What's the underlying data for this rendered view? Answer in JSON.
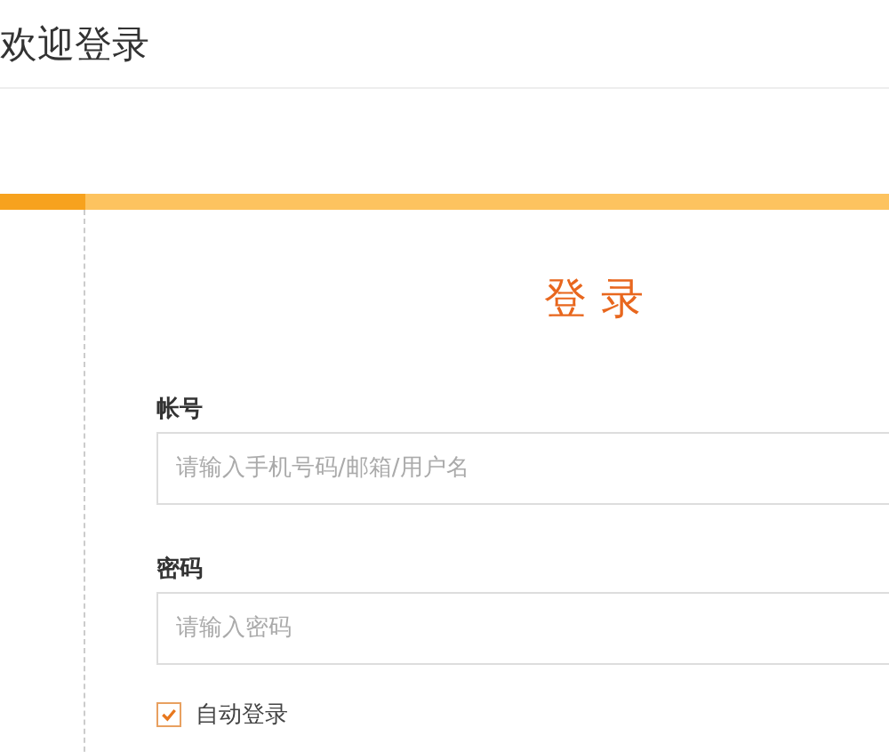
{
  "header": {
    "title": "欢迎登录"
  },
  "progress": {
    "level": 0.096
  },
  "form": {
    "title": "登录",
    "fields": [
      {
        "label": "帐号",
        "placeholder": "请输入手机号码/邮箱/用户名"
      },
      {
        "label": "密码",
        "placeholder": "请输入密码"
      }
    ],
    "remember": {
      "label": "自动登录",
      "checked": true
    }
  }
}
